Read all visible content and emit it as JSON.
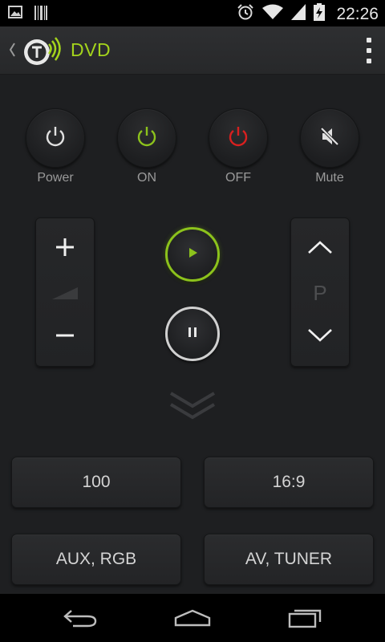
{
  "status_bar": {
    "time": "22:26",
    "icons": [
      "image-notification-icon",
      "barcode-notification-icon",
      "alarm-icon",
      "wifi-icon",
      "signal-icon",
      "battery-charging-icon"
    ]
  },
  "app_bar": {
    "title": "DVD",
    "back_icon": "chevron-left-icon",
    "logo_icon": "app-logo-icon",
    "menu_icon": "overflow-menu-icon"
  },
  "power_row": [
    {
      "label": "Power",
      "icon": "power-icon",
      "color": "#e0e0e0"
    },
    {
      "label": "ON",
      "icon": "power-icon",
      "color": "#8cc21c"
    },
    {
      "label": "OFF",
      "icon": "power-icon",
      "color": "#d8201f"
    },
    {
      "label": "Mute",
      "icon": "mute-icon",
      "color": "#e0e0e0"
    }
  ],
  "volume": {
    "plus_icon": "plus-icon",
    "level_icon": "volume-level-icon",
    "minus_icon": "minus-icon"
  },
  "channel": {
    "label": "P",
    "up_icon": "chevron-up-icon",
    "down_icon": "chevron-down-icon"
  },
  "transport": {
    "play_icon": "play-icon",
    "pause_icon": "pause-icon",
    "play_accent": "#8cc21c"
  },
  "expand_icon": "double-chevron-down-icon",
  "buttons": {
    "btn_100": "100",
    "btn_169": "16:9",
    "btn_aux": "AUX, RGB",
    "btn_av": "AV, TUNER"
  },
  "nav_bar": {
    "back_icon": "back-icon",
    "home_icon": "home-icon",
    "recents_icon": "recents-icon"
  }
}
